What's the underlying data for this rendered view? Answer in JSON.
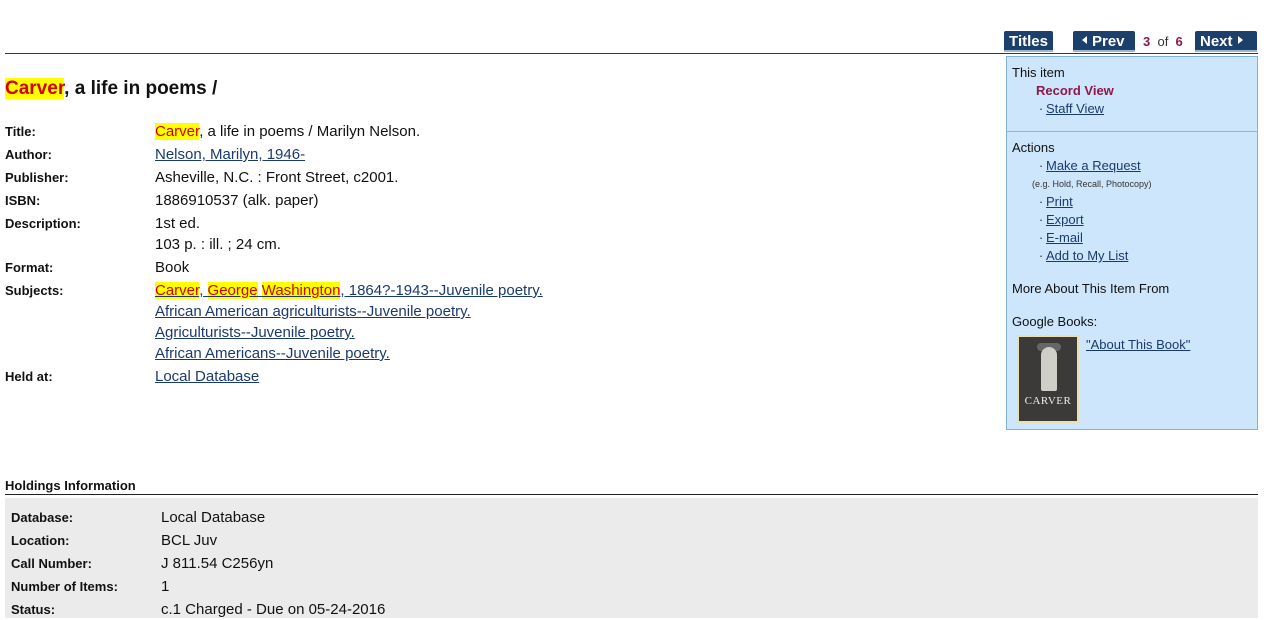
{
  "nav": {
    "titles_label": "Titles",
    "prev_label": "Prev",
    "next_label": "Next",
    "current": "3",
    "of_label": "of",
    "total": "6"
  },
  "title": {
    "highlight": "Carver",
    "rest": ", a life in poems /"
  },
  "record": {
    "title_label": "Title:",
    "title_hl": "Carver",
    "title_rest": ", a life in poems / Marilyn Nelson.",
    "author_label": "Author:",
    "author": "Nelson, Marilyn, 1946-",
    "publisher_label": "Publisher:",
    "publisher": "Asheville, N.C. : Front Street, c2001.",
    "isbn_label": "ISBN:",
    "isbn": "1886910537 (alk. paper)",
    "description_label": "Description:",
    "description_1": "1st ed.",
    "description_2": "103 p. : ill. ; 24 cm.",
    "format_label": "Format:",
    "format": "Book",
    "subjects_label": "Subjects:",
    "subject1_hl1": "Carver",
    "subject1_sep1": ",",
    "subject1_hl2": "George",
    "subject1_hl3": "Washington",
    "subject1_rest": ", 1864?-1943--Juvenile poetry.",
    "subject2": "African American agriculturists--Juvenile poetry.",
    "subject3": "Agriculturists--Juvenile poetry.",
    "subject4": "African Americans--Juvenile poetry.",
    "held_label": "Held at:",
    "held": "Local Database"
  },
  "sidebar": {
    "this_item": "This item",
    "record_view": "Record View",
    "staff_view": "Staff View",
    "actions": "Actions",
    "make_request": "Make a Request",
    "request_note": "(e.g. Hold, Recall, Photocopy)",
    "print": "Print",
    "export": "Export",
    "email": "E-mail",
    "add_to_list": "Add to My List",
    "more_about": "More About This Item From",
    "google_books": "Google Books:",
    "about_book": "\"About This Book\"",
    "cover_text": "CARVER"
  },
  "holdings": {
    "heading": "Holdings Information",
    "database_label": "Database:",
    "database": "Local Database",
    "location_label": "Location:",
    "location": "BCL Juv",
    "call_label": "Call Number:",
    "call": "J 811.54 C256yn",
    "items_label": "Number of Items:",
    "items": "1",
    "status_label": "Status:",
    "status": "c.1 Charged - Due on 05-24-2016"
  }
}
